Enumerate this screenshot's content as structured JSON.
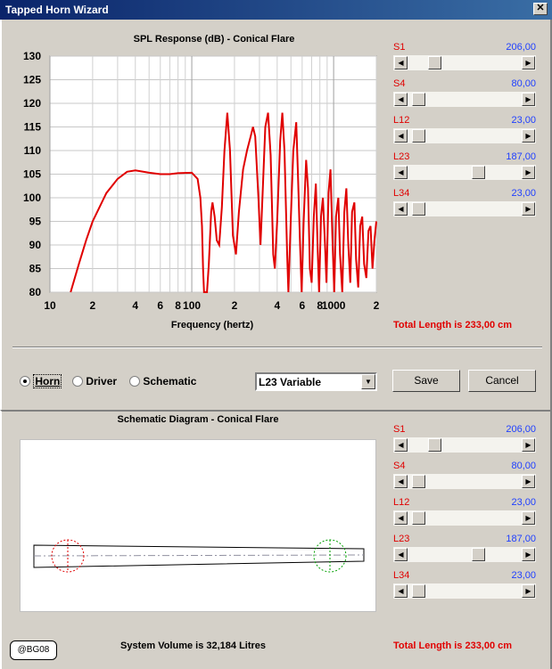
{
  "window": {
    "title": "Tapped Horn Wizard",
    "close_glyph": "✕"
  },
  "spl": {
    "title": "SPL Response (dB) - Conical Flare",
    "y_ticks": [
      "130",
      "125",
      "120",
      "115",
      "110",
      "105",
      "100",
      "95",
      "90",
      "85",
      "80"
    ],
    "x_ticks": [
      "10",
      "2",
      "4",
      "6",
      "8",
      "100",
      "2",
      "4",
      "6",
      "8",
      "1000",
      "2"
    ],
    "xlabel": "Frequency (hertz)",
    "total_length": "Total Length is 233,00 cm"
  },
  "chart_data": {
    "type": "line",
    "title": "SPL Response (dB) - Conical Flare",
    "xlabel": "Frequency (hertz)",
    "ylabel": "",
    "xscale": "log",
    "xlim": [
      10,
      2000
    ],
    "ylim": [
      80,
      130
    ],
    "grid": true,
    "series": [
      {
        "color": "#e00000",
        "points": [
          [
            14,
            80
          ],
          [
            16,
            86
          ],
          [
            18,
            91
          ],
          [
            20,
            95
          ],
          [
            25,
            101
          ],
          [
            30,
            104
          ],
          [
            35,
            105.5
          ],
          [
            40,
            105.8
          ],
          [
            50,
            105.3
          ],
          [
            60,
            105
          ],
          [
            70,
            105
          ],
          [
            80,
            105.2
          ],
          [
            100,
            105.3
          ],
          [
            110,
            104
          ],
          [
            115,
            100
          ],
          [
            118,
            94
          ],
          [
            120,
            85
          ],
          [
            122,
            80
          ],
          [
            128,
            80
          ],
          [
            132,
            86
          ],
          [
            137,
            97
          ],
          [
            140,
            99
          ],
          [
            145,
            96
          ],
          [
            150,
            91
          ],
          [
            156,
            90
          ],
          [
            163,
            98
          ],
          [
            170,
            110
          ],
          [
            178,
            118
          ],
          [
            186,
            110
          ],
          [
            195,
            92
          ],
          [
            205,
            88
          ],
          [
            215,
            97
          ],
          [
            230,
            106
          ],
          [
            245,
            110
          ],
          [
            260,
            113
          ],
          [
            270,
            115
          ],
          [
            280,
            113
          ],
          [
            295,
            100
          ],
          [
            305,
            90
          ],
          [
            315,
            100
          ],
          [
            330,
            115
          ],
          [
            345,
            118
          ],
          [
            360,
            109
          ],
          [
            375,
            88
          ],
          [
            385,
            85
          ],
          [
            400,
            95
          ],
          [
            420,
            112
          ],
          [
            435,
            118
          ],
          [
            450,
            110
          ],
          [
            470,
            88
          ],
          [
            480,
            80
          ],
          [
            500,
            96
          ],
          [
            520,
            110
          ],
          [
            545,
            116
          ],
          [
            560,
            105
          ],
          [
            580,
            90
          ],
          [
            595,
            80
          ],
          [
            615,
            95
          ],
          [
            640,
            108
          ],
          [
            660,
            102
          ],
          [
            680,
            85
          ],
          [
            700,
            82
          ],
          [
            725,
            96
          ],
          [
            750,
            103
          ],
          [
            770,
            90
          ],
          [
            790,
            80
          ],
          [
            815,
            96
          ],
          [
            840,
            100
          ],
          [
            870,
            90
          ],
          [
            890,
            82
          ],
          [
            920,
            101
          ],
          [
            950,
            106
          ],
          [
            980,
            92
          ],
          [
            1010,
            80
          ],
          [
            1040,
            96
          ],
          [
            1080,
            100
          ],
          [
            1110,
            88
          ],
          [
            1150,
            80
          ],
          [
            1190,
            97
          ],
          [
            1230,
            102
          ],
          [
            1270,
            90
          ],
          [
            1310,
            82
          ],
          [
            1350,
            97
          ],
          [
            1400,
            99
          ],
          [
            1440,
            87
          ],
          [
            1490,
            81
          ],
          [
            1540,
            94
          ],
          [
            1590,
            96
          ],
          [
            1640,
            86
          ],
          [
            1700,
            83
          ],
          [
            1760,
            93
          ],
          [
            1820,
            94
          ],
          [
            1880,
            85
          ],
          [
            1940,
            91
          ],
          [
            2000,
            95
          ]
        ]
      }
    ]
  },
  "sliders_top": [
    {
      "label": "S1",
      "value": "206,00",
      "pos": 0.206
    },
    {
      "label": "S4",
      "value": "80,00",
      "pos": 0.04
    },
    {
      "label": "L12",
      "value": "23,00",
      "pos": 0.04
    },
    {
      "label": "L23",
      "value": "187,00",
      "pos": 0.64
    },
    {
      "label": "L34",
      "value": "23,00",
      "pos": 0.04
    }
  ],
  "view_options": {
    "horn": "Horn",
    "driver": "Driver",
    "schematic": "Schematic",
    "selected": "horn"
  },
  "combo": {
    "value": "L23 Variable"
  },
  "buttons": {
    "save": "Save",
    "cancel": "Cancel"
  },
  "schematic": {
    "title": "Schematic Diagram - Conical Flare",
    "system_volume": "System Volume is 32,184 Litres",
    "total_length": "Total Length is 233,00 cm",
    "logo": "@BG08"
  },
  "sliders_bottom": [
    {
      "label": "S1",
      "value": "206,00",
      "pos": 0.206
    },
    {
      "label": "S4",
      "value": "80,00",
      "pos": 0.04
    },
    {
      "label": "L12",
      "value": "23,00",
      "pos": 0.04
    },
    {
      "label": "L23",
      "value": "187,00",
      "pos": 0.64
    },
    {
      "label": "L34",
      "value": "23,00",
      "pos": 0.04
    }
  ]
}
